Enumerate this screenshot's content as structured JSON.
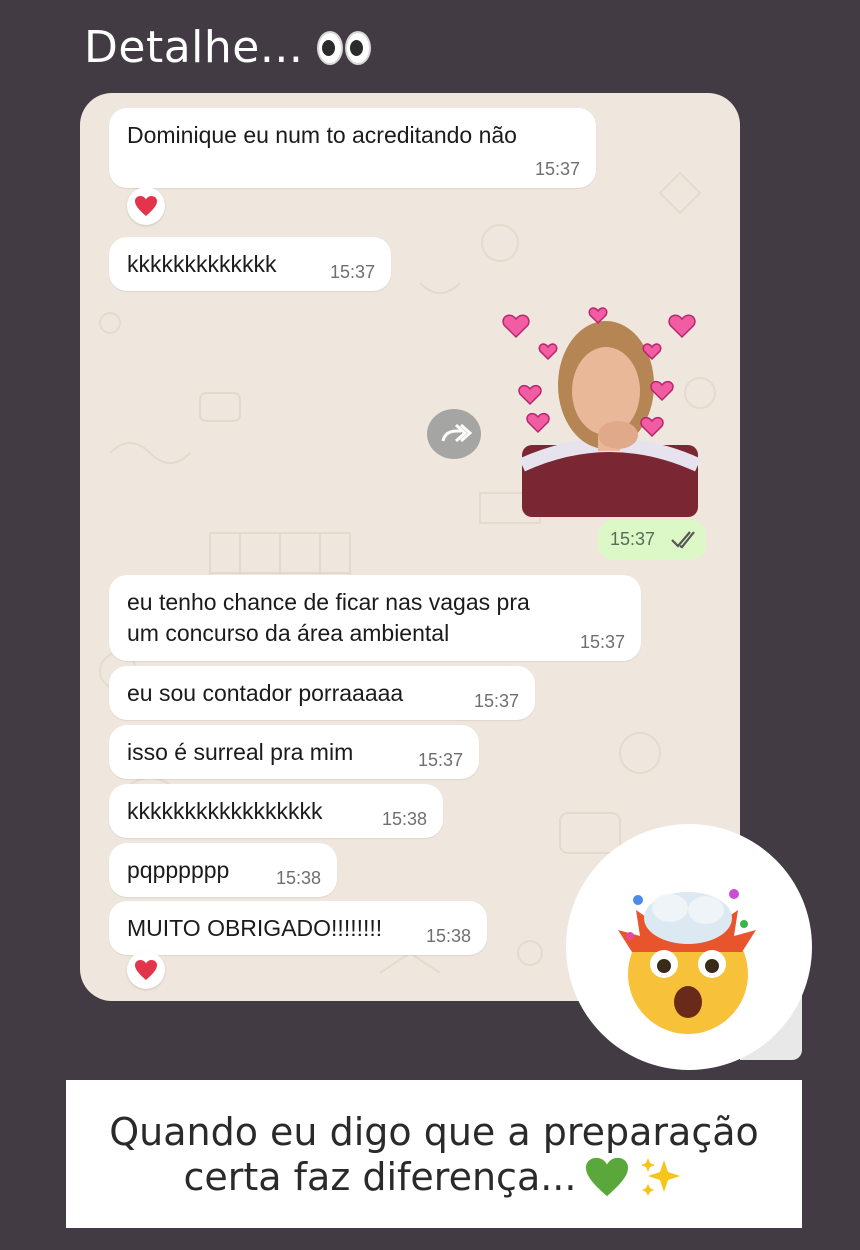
{
  "story": {
    "title": "Detalhe...",
    "title_emoji": "eyes-emoji",
    "caption_line1": "Quando eu digo que a preparação",
    "caption_line2": "certa faz diferença...",
    "caption_emojis": [
      "green-heart-emoji",
      "sparkles-emoji"
    ]
  },
  "chat": {
    "messages": [
      {
        "text": "Dominique eu num to acreditando não",
        "time": "15:37",
        "reaction": "heart-icon"
      },
      {
        "text": "kkkkkkkkkkkkk",
        "time": "15:37"
      },
      {
        "text": "eu tenho chance de ficar nas vagas pra",
        "text2": "um concurso da área ambiental",
        "time": "15:37"
      },
      {
        "text": "eu sou contador porraaaaa",
        "time": "15:37"
      },
      {
        "text": "isso é surreal pra mim",
        "time": "15:37"
      },
      {
        "text": "kkkkkkkkkkkkkkkkk",
        "time": "15:38"
      },
      {
        "text": "pqpppppp",
        "time": "15:38"
      },
      {
        "text": "MUITO OBRIGADO!!!!!!!!",
        "time": "15:38",
        "reaction": "heart-icon"
      }
    ],
    "outgoing_sticker": {
      "time": "15:37",
      "status": "read-double-check-icon"
    }
  },
  "colors": {
    "background": "#423b43",
    "chat_wallpaper": "#efe7dd",
    "incoming_bubble": "#ffffff",
    "outgoing_bubble": "#dcf8c6",
    "heart": "#e2344a"
  }
}
